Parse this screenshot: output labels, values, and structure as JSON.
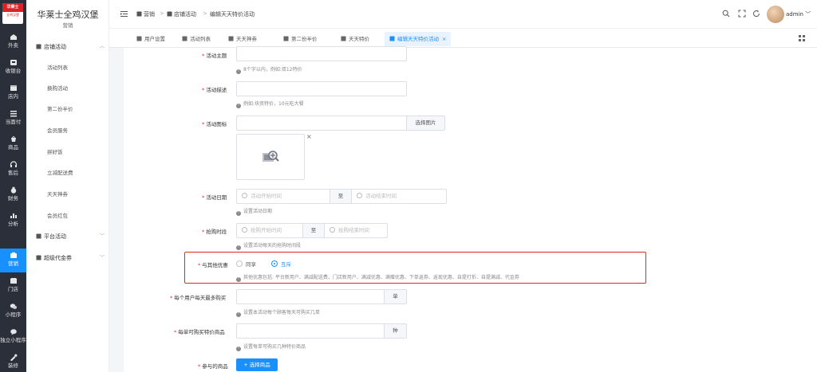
{
  "rail": {
    "logo_text": "华莱士",
    "logo_sub": "全鸡汉堡",
    "items": [
      {
        "label": "外卖",
        "icon": "home-icon"
      },
      {
        "label": "收银台",
        "icon": "cashier-icon"
      },
      {
        "label": "店内",
        "icon": "store-icon"
      },
      {
        "label": "当面付",
        "icon": "list-icon"
      },
      {
        "label": "商品",
        "icon": "goods-icon"
      },
      {
        "label": "售后",
        "icon": "headset-icon"
      },
      {
        "label": "财务",
        "icon": "money-bag-icon"
      },
      {
        "label": "分析",
        "icon": "bar-chart-icon"
      },
      {
        "label": "营销",
        "icon": "marketing-icon"
      },
      {
        "label": "门店",
        "icon": "shop-icon"
      },
      {
        "label": "小程序",
        "icon": "wechat-icon"
      },
      {
        "label": "独立小程序",
        "icon": "chat-bubble-icon"
      },
      {
        "label": "装修",
        "icon": "decorate-icon"
      }
    ]
  },
  "subside": {
    "brand_title": "华莱士全鸡汉堡",
    "brand_sub": "营销",
    "group1": "店铺活动",
    "items": [
      "活动列表",
      "换购活动",
      "第二份半价",
      "会员服务",
      "拼好饭",
      "立减配送费",
      "天天神券",
      "会员红包"
    ],
    "group2": "平台活动",
    "group3": "超级代金券"
  },
  "header": {
    "crumbs": [
      "营销",
      "店铺活动",
      "编辑天天特价活动"
    ],
    "user": "admin"
  },
  "tabs": [
    {
      "label": "用户设置"
    },
    {
      "label": "活动列表"
    },
    {
      "label": "天天神券"
    },
    {
      "label": "第二份半价"
    },
    {
      "label": "天天特价"
    },
    {
      "label": "编辑天天特价活动",
      "close": "×"
    }
  ],
  "form": {
    "theme_label": "活动主题",
    "theme_hint": "8个字以内，例如:双12特价",
    "desc_label": "活动描述",
    "desc_hint": "例如:块资特价，10元吃大餐",
    "image_label": "活动图标",
    "image_btn": "选择图片",
    "image_close": "×",
    "date_label": "活动日期",
    "date_start": "活动开始时间",
    "date_to": "至",
    "date_end": "活动结束时间",
    "date_hint": "设置活动日期",
    "time_label": "抢购时段",
    "time_start": "抢购开始时间",
    "time_to": "至",
    "time_end": "抢购结束时间",
    "time_hint": "设置活动每天的抢购时间段",
    "share_label": "与其他优惠",
    "share_opt1": "同享",
    "share_opt2": "互斥",
    "share_hint": "其他优惠包括: 平台新用户、满减配送费、门店新用户、满减优惠、满赠优惠、下单返券、返现优惠、自提打折、自提满减、代金券",
    "per_user_label": "每个用户每天最多购买",
    "per_user_unit": "单",
    "per_user_hint": "设置本活动每个顾客每天可购买几单",
    "per_order_label": "每单可购买特价商品",
    "per_order_unit": "种",
    "per_order_hint": "设置每单可购买几种特价商品",
    "goods_label": "参与的商品",
    "goods_btn": "+ 选择商品",
    "hint_mark": "!"
  },
  "colors": {
    "accent": "#1890ff",
    "rail_bg": "#2b2f3a",
    "highlight": "#e0281f"
  }
}
